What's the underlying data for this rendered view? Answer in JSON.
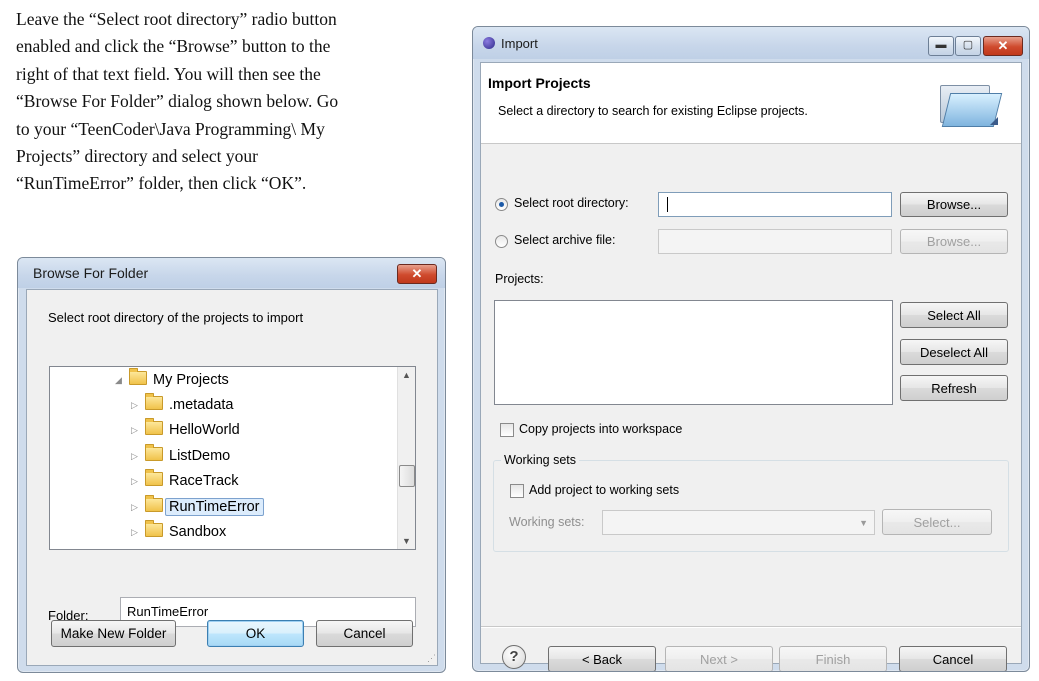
{
  "instructions": {
    "lines": [
      "Leave the “Select root directory” radio button",
      "enabled and click the “Browse” button to the",
      "right of that text field.  You will then see the",
      "“Browse For Folder” dialog shown below.  Go",
      "to your “TeenCoder\\Java Programming\\ My",
      "Projects”  directory  and  select  your",
      "“RunTimeError” folder, then click “OK”."
    ]
  },
  "browse_dialog": {
    "title": "Browse For Folder",
    "close_glyph": "✕",
    "description": "Select root directory of the projects to import",
    "tree": {
      "root": "My Projects",
      "children": [
        ".metadata",
        "HelloWorld",
        "ListDemo",
        "RaceTrack",
        "RunTimeError",
        "Sandbox"
      ],
      "selected": "RunTimeError"
    },
    "folder_label": "Folder:",
    "folder_value": "RunTimeError",
    "buttons": {
      "make_new_folder": "Make New Folder",
      "ok": "OK",
      "cancel": "Cancel"
    }
  },
  "import_dialog": {
    "title": "Import",
    "header_title": "Import Projects",
    "header_subtitle": "Select a directory to search for existing Eclipse projects.",
    "select_root_label": "Select root directory:",
    "select_root_value": "",
    "select_archive_label": "Select archive file:",
    "browse_label": "Browse...",
    "projects_label": "Projects:",
    "select_all": "Select All",
    "deselect_all": "Deselect All",
    "refresh": "Refresh",
    "copy_projects_label": "Copy projects into workspace",
    "working_sets_group": "Working sets",
    "add_to_working_sets_label": "Add project to working sets",
    "working_sets_label": "Working sets:",
    "select_label": "Select...",
    "help_glyph": "?",
    "back": "< Back",
    "next": "Next >",
    "finish": "Finish",
    "cancel": "Cancel"
  },
  "colors": {
    "accent": "#1c5aa8",
    "close_red": "#c0391c",
    "selection": "#dcecfc"
  }
}
